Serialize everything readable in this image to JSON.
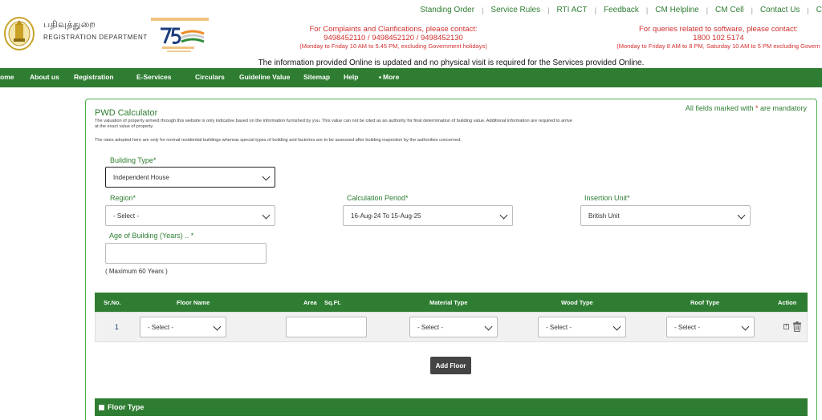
{
  "header": {
    "dept_tamil": "பதிவுத்துறை",
    "dept_english": "REGISTRATION DEPARTMENT",
    "top_links": [
      "Standing Order",
      "Service Rules",
      "RTI ACT",
      "Feedback",
      "CM Helpline",
      "CM Cell",
      "Contact Us",
      "C"
    ],
    "complaints": {
      "line1": "For Complaints and Clarifications, please contact:",
      "line2": "9498452110 / 9498452120 / 9498452130",
      "line3": "(Monday to Friday 10 AM to 5.45 PM, excluding Government holidays)"
    },
    "software": {
      "line1": "For queries related to software, please contact:",
      "line2": "1800 102 5174",
      "line3": "(Monday to Friday 8 AM to 8 PM, Saturday 10 AM to 5 PM excluding Govern"
    },
    "notice": "The information provided Online is updated and no physical visit is required for the Services provided Online."
  },
  "nav": {
    "items": [
      "ome",
      "About us",
      "Registration",
      "E-Services",
      "Circulars",
      "Guideline Value",
      "Sitemap",
      "Help",
      "More"
    ]
  },
  "form": {
    "title": "PWD Calculator",
    "mandatory_prefix": "All fields marked with ",
    "mandatory_star": "*",
    "mandatory_suffix": " are mandatory",
    "desc1": "The valuation of property arrived through this website is only indicative based on the information furnished by you. This value can not be cited as an authority for final determination of building value. Additional information are required to arrive at the exact value of property.",
    "desc2": "The rates adopted here are only for normal residential buildings whereas special types of building and factories are to be assessed after building inspection by the authorities concerned.",
    "building_type": {
      "label": "Building Type",
      "value": "Independent House"
    },
    "region": {
      "label": "Region",
      "value": "- Select -"
    },
    "calculation_period": {
      "label": "Calculation Period",
      "value": "16-Aug-24 To 15-Aug-25"
    },
    "insertion_unit": {
      "label": "Insertion Unit",
      "value": "British Unit"
    },
    "age": {
      "label": "Age of Building (Years) .. ",
      "value": "",
      "hint": "( Maximum 60 Years )"
    },
    "star": "*"
  },
  "table": {
    "headers": [
      "Sr.No.",
      "Floor Name",
      "Area",
      "Sq.Ft.",
      "Material Type",
      "Wood Type",
      "Roof Type",
      "Action"
    ],
    "row": {
      "sr_no": "1",
      "floor_name": "- Select -",
      "area": "",
      "material_type": "- Select -",
      "wood_type": "- Select -",
      "roof_type": "- Select -",
      "add_symbol": "+"
    },
    "add_floor_label": "Add Floor",
    "section_label": "Floor Type"
  },
  "colors": {
    "brand_green": "#2e7d32",
    "alert_red": "#d32f2f",
    "button_dark": "#444444"
  }
}
